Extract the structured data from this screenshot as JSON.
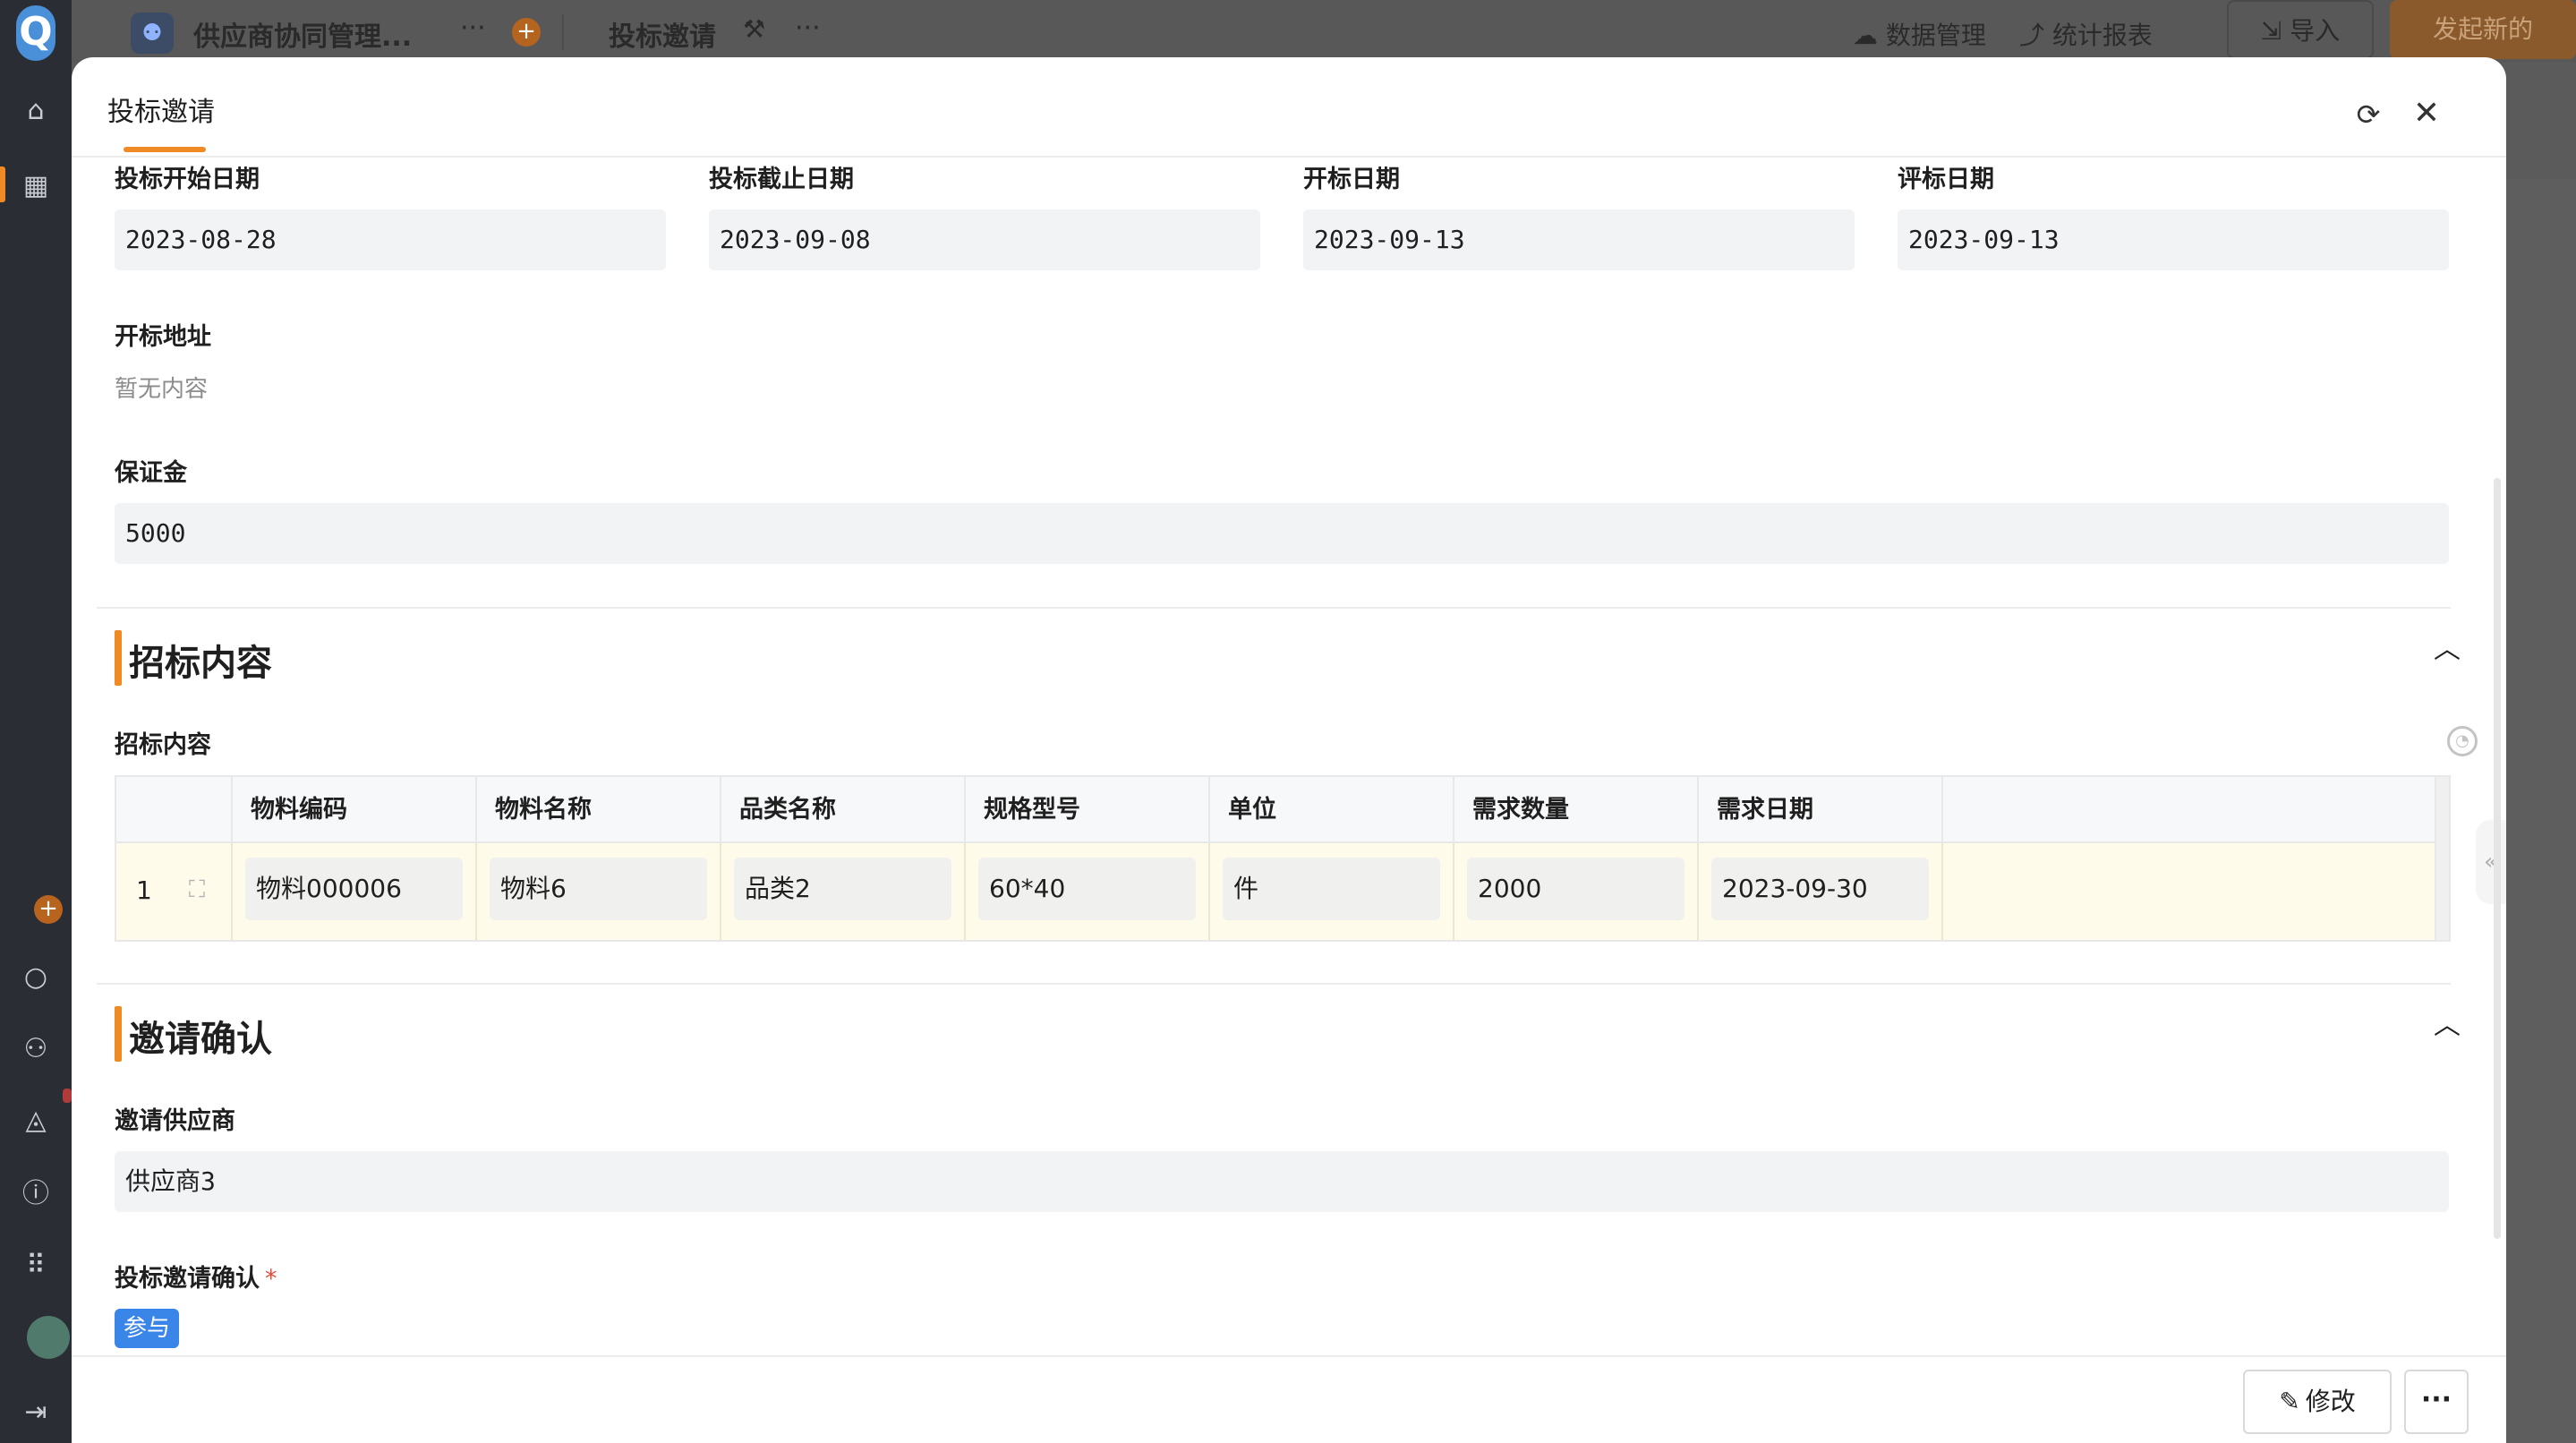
{
  "topbar": {
    "app_title": "供应商协同管理...",
    "page_title": "投标邀请",
    "data_mgmt": "数据管理",
    "stats": "统计报表",
    "import_label": "导入",
    "new_label": "发起新的"
  },
  "modal": {
    "title": "投标邀请",
    "fields": {
      "bid_start_label": "投标开始日期",
      "bid_start_value": "2023-08-28",
      "bid_end_label": "投标截止日期",
      "bid_end_value": "2023-09-08",
      "open_date_label": "开标日期",
      "open_date_value": "2023-09-13",
      "eval_date_label": "评标日期",
      "eval_date_value": "2023-09-13",
      "open_addr_label": "开标地址",
      "open_addr_empty": "暂无内容",
      "deposit_label": "保证金",
      "deposit_value": "5000"
    },
    "tender_section": {
      "title": "招标内容",
      "table_label": "招标内容",
      "columns": [
        "物料编码",
        "物料名称",
        "品类名称",
        "规格型号",
        "单位",
        "需求数量",
        "需求日期"
      ],
      "rows": [
        {
          "num": "1",
          "cells": [
            "物料000006",
            "物料6",
            "品类2",
            "60*40",
            "件",
            "2000",
            "2023-09-30"
          ]
        }
      ]
    },
    "invite_section": {
      "title": "邀请确认",
      "supplier_label": "邀请供应商",
      "supplier_value": "供应商3",
      "confirm_label": "投标邀请确认",
      "required_mark": "*",
      "confirm_tag": "参与"
    },
    "footer": {
      "edit_label": "修改",
      "more_label": "···"
    }
  }
}
